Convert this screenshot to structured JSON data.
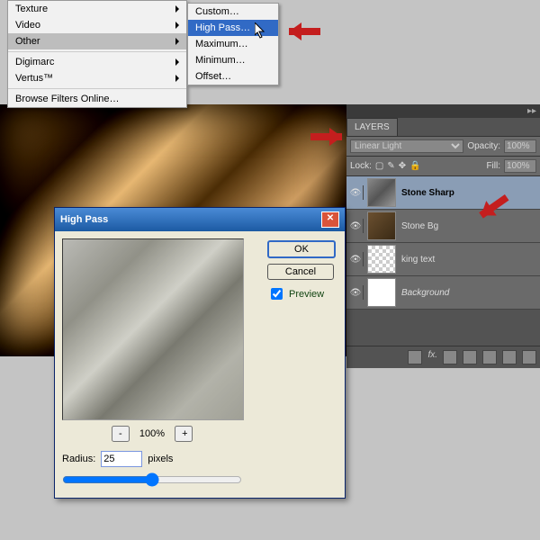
{
  "menu": {
    "items": [
      "Texture",
      "Video",
      "Other",
      "Digimarc",
      "Vertus™",
      "Browse Filters Online…"
    ],
    "highlighted": "Other",
    "submenu": [
      "Custom…",
      "High Pass…",
      "Maximum…",
      "Minimum…",
      "Offset…"
    ],
    "sub_highlighted": "High Pass…"
  },
  "layers": {
    "tab": "LAYERS",
    "blend": "Linear Light",
    "opacity_label": "Opacity:",
    "opacity": "100%",
    "lock_label": "Lock:",
    "fill_label": "Fill:",
    "fill": "100%",
    "rows": [
      {
        "name": "Stone Sharp",
        "selected": true,
        "thumb": "stone"
      },
      {
        "name": "Stone Bg",
        "selected": false,
        "thumb": "bg"
      },
      {
        "name": "king text",
        "selected": false,
        "thumb": "txt"
      },
      {
        "name": "Background",
        "selected": false,
        "thumb": "white",
        "italic": true
      }
    ]
  },
  "dialog": {
    "title": "High Pass",
    "ok": "OK",
    "cancel": "Cancel",
    "preview_label": "Preview",
    "zoom": "100%",
    "radius_label": "Radius:",
    "radius_value": "25",
    "radius_unit": "pixels"
  }
}
